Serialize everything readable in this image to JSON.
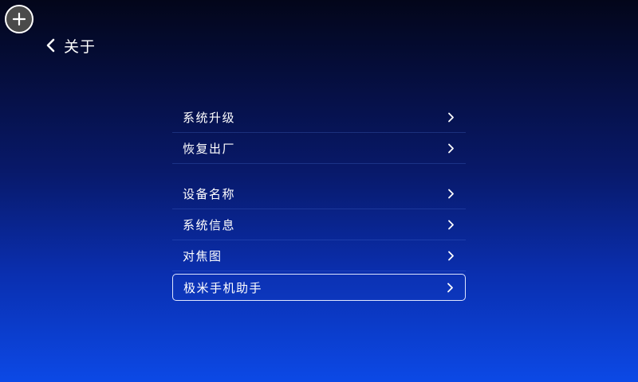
{
  "header": {
    "title": "关于"
  },
  "menu": {
    "group1": [
      {
        "label": "系统升级"
      },
      {
        "label": "恢复出厂"
      }
    ],
    "group2": [
      {
        "label": "设备名称"
      },
      {
        "label": "系统信息"
      },
      {
        "label": "对焦图"
      },
      {
        "label": "极米手机助手"
      }
    ],
    "focused_item": "极米手机助手"
  },
  "icons": {
    "add": "plus-circle-icon",
    "back": "chevron-left-icon",
    "row_arrow": "chevron-right-icon"
  },
  "colors": {
    "background_top": "#03061a",
    "background_bottom": "#0c49e6",
    "focus_border": "#dfe6ff"
  }
}
